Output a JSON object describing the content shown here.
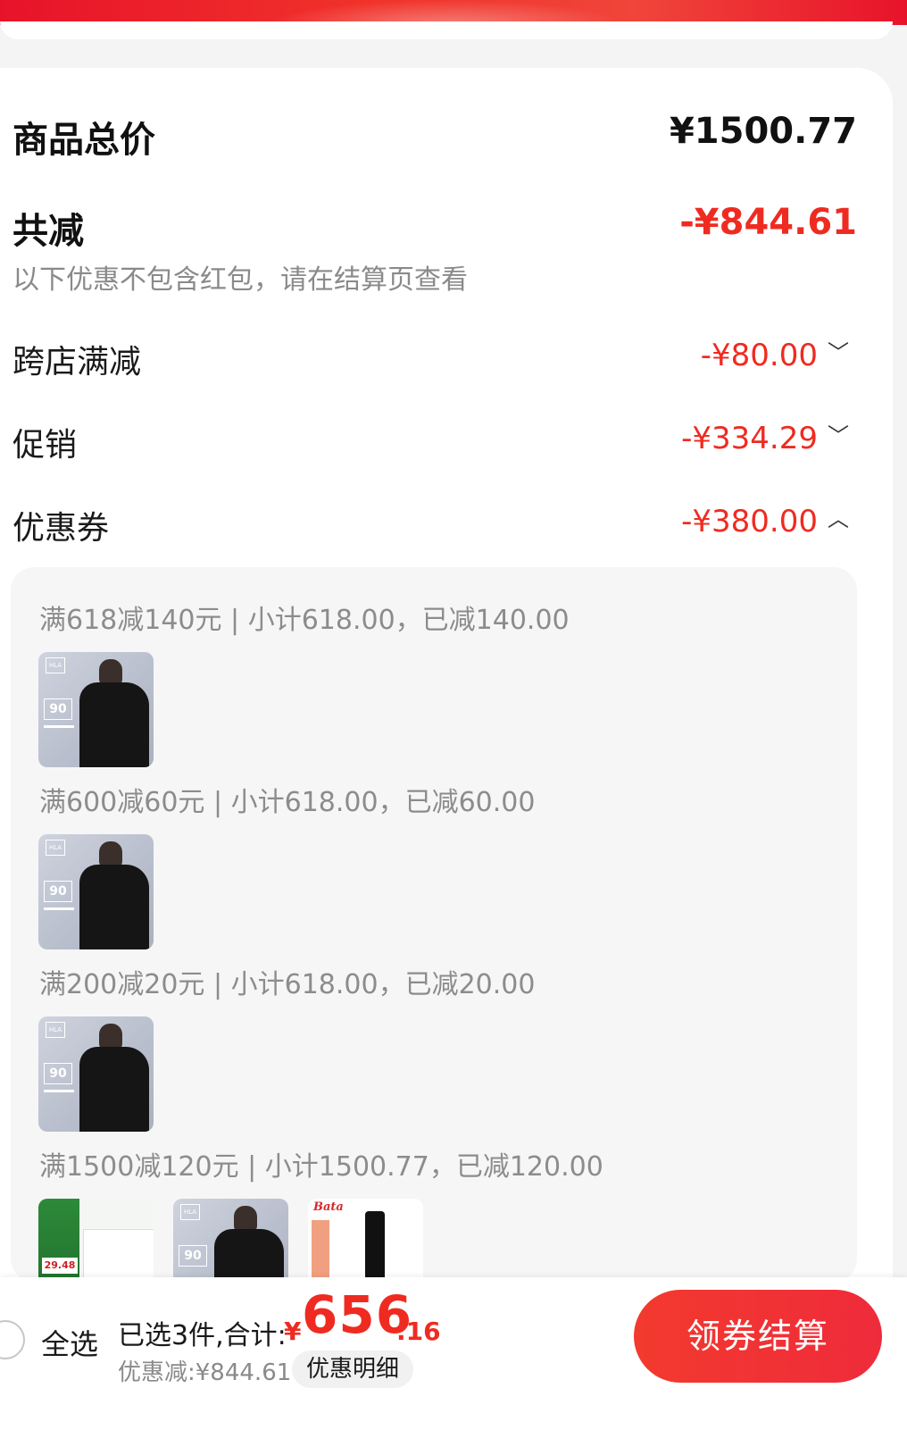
{
  "summary": {
    "total_label": "商品总价",
    "total_value": "¥1500.77",
    "reduce_label": "共减",
    "reduce_value": "-¥844.61",
    "note": "以下优惠不包含红包，请在结算页查看"
  },
  "details": [
    {
      "label": "跨店满减",
      "value": "-¥80.00",
      "chevron": "chevron-down-icon",
      "glyph": "﹀"
    },
    {
      "label": "促销",
      "value": "-¥334.29",
      "chevron": "chevron-down-icon",
      "glyph": "﹀"
    },
    {
      "label": "优惠券",
      "value": "-¥380.00",
      "chevron": "chevron-up-icon",
      "glyph": "︿"
    }
  ],
  "coupons": [
    {
      "text": "满618减140元 | 小计618.00，已减140.00"
    },
    {
      "text": "满600减60元 | 小计618.00，已减60.00"
    },
    {
      "text": "满200减20元 | 小计618.00，已减20.00"
    },
    {
      "text": "满1500减120元 | 小计1500.77，已减120.00"
    }
  ],
  "thumb_text": {
    "badge": "90",
    "logo": "HLA",
    "socket_price": "29.48",
    "boot_brand": "Bata"
  },
  "footer": {
    "select_all": "全选",
    "summary_text": "已选3件,合计:",
    "currency": "¥",
    "price_main": "656",
    "price_decimal": ".16",
    "discount_text": "优惠减:¥844.61",
    "detail_button": "优惠明细",
    "checkout_button": "领券结算"
  },
  "colors": {
    "accent": "#ef2b21",
    "bar_red": "#e8132a"
  }
}
